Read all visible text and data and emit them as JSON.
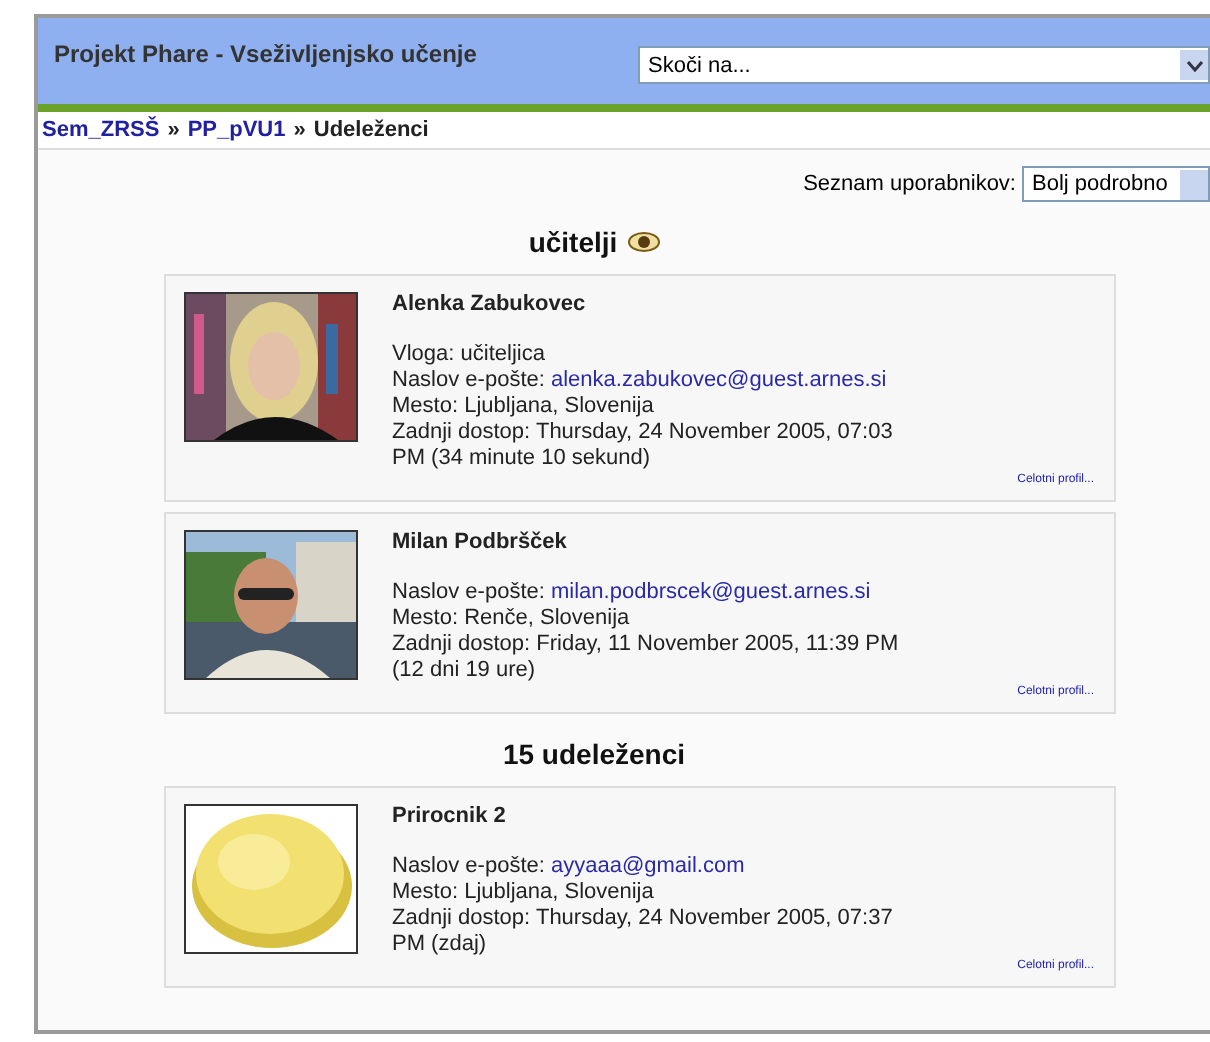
{
  "header": {
    "title": "Projekt Phare - Vseživljenjsko učenje",
    "jump": {
      "value": "Skoči na..."
    }
  },
  "breadcrumb": [
    {
      "label": "Sem_ZRSŠ",
      "link": true
    },
    {
      "label": "PP_pVU1",
      "link": true
    },
    {
      "label": "Udeleženci",
      "link": false
    }
  ],
  "breadcrumb_separator": "»",
  "list_control": {
    "label": "Seznam uporabnikov:",
    "value": "Bolj podrobno"
  },
  "sections": [
    {
      "heading": "učitelji",
      "eye_icon": true,
      "people": [
        {
          "name": "Alenka Zabukovec",
          "avatar": {
            "kind": "picture"
          },
          "lines": [
            {
              "label": "Vloga:",
              "value": "učiteljica"
            },
            {
              "label": "Naslov e-pošte:",
              "value": "alenka.zabukovec@guest.arnes.si",
              "link": true
            },
            {
              "label": "Mesto:",
              "value": "Ljubljana, Slovenija"
            },
            {
              "label": "Zadnji dostop:",
              "value": "Thursday, 24 November 2005, 07:03 PM  (34 minute 10 sekund)"
            }
          ],
          "profile_link": "Celotni profil..."
        },
        {
          "name": "Milan Podbršček",
          "avatar": {
            "kind": "picture"
          },
          "lines": [
            {
              "label": "Naslov e-pošte:",
              "value": "milan.podbrscek@guest.arnes.si",
              "link": true
            },
            {
              "label": "Mesto:",
              "value": "Renče, Slovenija"
            },
            {
              "label": "Zadnji dostop:",
              "value": "Friday, 11 November 2005, 11:39 PM (12 dni 19 ure)"
            }
          ],
          "profile_link": "Celotni profil..."
        }
      ]
    },
    {
      "heading": "15 udeleženci",
      "eye_icon": false,
      "people": [
        {
          "name": "Prirocnik 2",
          "avatar": {
            "kind": "picture"
          },
          "lines": [
            {
              "label": "Naslov e-pošte:",
              "value": "ayyaaa@gmail.com",
              "link": true
            },
            {
              "label": "Mesto:",
              "value": "Ljubljana, Slovenija"
            },
            {
              "label": "Zadnji dostop:",
              "value": "Thursday, 24 November 2005, 07:37 PM  (zdaj)"
            }
          ],
          "profile_link": "Celotni profil..."
        }
      ]
    }
  ]
}
